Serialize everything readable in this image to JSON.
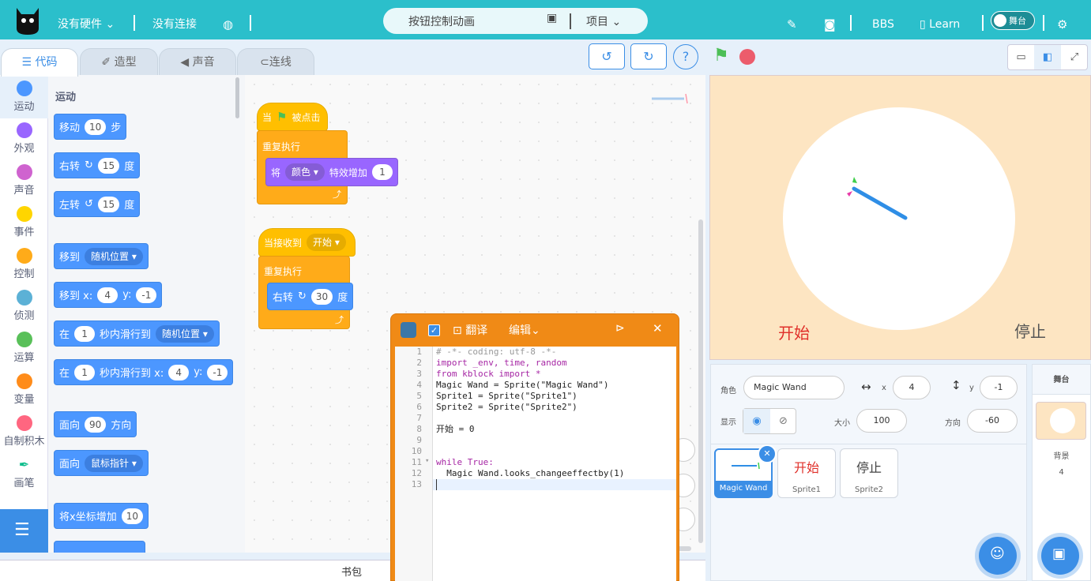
{
  "topbar": {
    "hardware": "没有硬件",
    "connection": "没有连接",
    "project_name": "按钮控制动画",
    "project_menu": "项目",
    "bbs": "BBS",
    "learn": "Learn",
    "stage_toggle": "舞台"
  },
  "tabs": [
    "代码",
    "造型",
    "声音",
    "连线"
  ],
  "categories": [
    {
      "label": "运动",
      "color": "#4c97ff"
    },
    {
      "label": "外观",
      "color": "#9966ff"
    },
    {
      "label": "声音",
      "color": "#cf63cf"
    },
    {
      "label": "事件",
      "color": "#ffd500"
    },
    {
      "label": "控制",
      "color": "#ffab19"
    },
    {
      "label": "侦测",
      "color": "#5cb1d6"
    },
    {
      "label": "运算",
      "color": "#59c059"
    },
    {
      "label": "变量",
      "color": "#ff8c1a"
    },
    {
      "label": "自制积木",
      "color": "#ff6680"
    },
    {
      "label": "画笔",
      "color": "#0fbd8c"
    }
  ],
  "palette": {
    "section": "运动",
    "move": {
      "label": "移动",
      "value": "10",
      "unit": "步"
    },
    "turn_right": {
      "label": "右转",
      "value": "15",
      "unit": "度"
    },
    "turn_left": {
      "label": "左转",
      "value": "15",
      "unit": "度"
    },
    "goto": {
      "label": "移到",
      "option": "随机位置"
    },
    "goto_xy": {
      "label": "移到 x:",
      "x": "4",
      "ylabel": "y:",
      "y": "-1"
    },
    "glide": {
      "label": "在",
      "secs": "1",
      "mid": "秒内滑行到",
      "option": "随机位置"
    },
    "glide_xy": {
      "label": "在",
      "secs": "1",
      "mid": "秒内滑行到 x:",
      "x": "4",
      "ylabel": "y:",
      "y": "-1"
    },
    "point_dir": {
      "label": "面向",
      "value": "90",
      "unit": "方向"
    },
    "point_towards": {
      "label": "面向",
      "option": "鼠标指针"
    },
    "change_x": {
      "label": "将x坐标增加",
      "value": "10"
    }
  },
  "script1": {
    "hat_when": "当",
    "hat_clicked": "被点击",
    "forever": "重复执行",
    "effect_label": "将",
    "effect_option": "颜色",
    "effect_mid": "特效增加",
    "effect_value": "1"
  },
  "script2": {
    "hat_label": "当接收到",
    "hat_option": "开始",
    "forever": "重复执行",
    "turn_label": "右转",
    "turn_value": "30",
    "turn_unit": "度"
  },
  "bag_label": "书包",
  "python": {
    "translate": "翻译",
    "edit": "编辑",
    "lines": [
      "1",
      "2",
      "3",
      "4",
      "5",
      "6",
      "7",
      "8",
      "9",
      "10",
      "11",
      "12",
      "13"
    ],
    "code": [
      "# -*- coding: utf-8 -*-",
      "import _env, time, random",
      "from kblock import *",
      "Magic Wand = Sprite(\"Magic Wand\")",
      "Sprite1 = Sprite(\"Sprite1\")",
      "Sprite2 = Sprite(\"Sprite2\")",
      "",
      "开始 = 0",
      "",
      "",
      "while True:",
      "  Magic Wand.looks_changeeffectby(1)",
      ""
    ]
  },
  "stage": {
    "start": "开始",
    "stop": "停止"
  },
  "sprite_info": {
    "sprite_label": "角色",
    "sprite_name": "Magic Wand",
    "x_label": "x",
    "x": "4",
    "y_label": "y",
    "y": "-1",
    "show_label": "显示",
    "size_label": "大小",
    "size": "100",
    "dir_label": "方向",
    "direction": "-60"
  },
  "sprites": [
    {
      "name": "Magic Wand",
      "preview": ""
    },
    {
      "name": "Sprite1",
      "preview": "开始"
    },
    {
      "name": "Sprite2",
      "preview": "停止"
    }
  ],
  "stage_col": {
    "title": "舞台",
    "backdrop_label": "背景",
    "backdrop_count": "4"
  },
  "colors": {
    "topbar": "#2bbfcb",
    "accent": "#3b8ee6",
    "python_window": "#f08a16",
    "stage_bg": "#fde5c2"
  }
}
